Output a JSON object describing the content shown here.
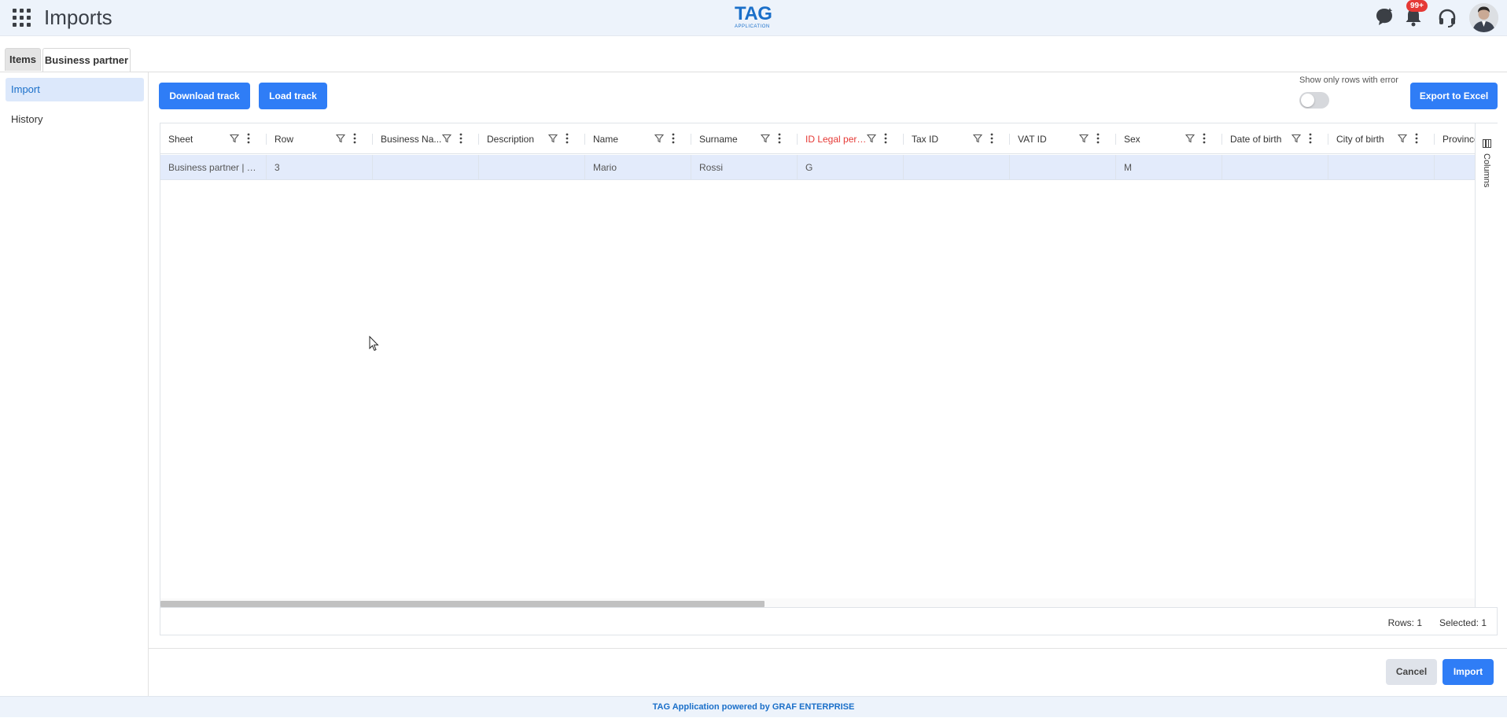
{
  "header": {
    "title": "Imports",
    "logo_main": "TAG",
    "logo_sub": "APPLICATION",
    "notification_badge": "99+",
    "icons": [
      "apps-grid-icon",
      "chat-heart-icon",
      "bell-icon",
      "headset-icon"
    ]
  },
  "tabs": [
    {
      "label": "Items",
      "active": false
    },
    {
      "label": "Business partner",
      "active": true
    }
  ],
  "sidebar": {
    "items": [
      {
        "label": "Import",
        "active": true
      },
      {
        "label": "History",
        "active": false
      }
    ]
  },
  "toolbar": {
    "download_label": "Download track",
    "load_label": "Load track",
    "toggle_label": "Show only rows with error",
    "toggle_on": false,
    "export_label": "Export to Excel"
  },
  "grid": {
    "columns": [
      "Sheet",
      "Row",
      "Business Na...",
      "Description",
      "Name",
      "Surname",
      "ID Legal pers...",
      "Tax ID",
      "VAT ID",
      "Sex",
      "Date of birth",
      "City of birth",
      "Province"
    ],
    "error_column": "ID Legal pers...",
    "rows": [
      [
        "Business partner | Tr...",
        "3",
        "",
        "",
        "Mario",
        "Rossi",
        "G",
        "",
        "",
        "M",
        "",
        "",
        ""
      ]
    ],
    "side_panel_label": "Columns",
    "footer_rows": "Rows: 1",
    "footer_selected": "Selected: 1"
  },
  "actions": {
    "cancel_label": "Cancel",
    "import_label": "Import"
  },
  "footer": {
    "text": "TAG Application powered by GRAF ENTERPRISE"
  },
  "colors": {
    "primary": "#2f7df6",
    "brand": "#1a6fc9",
    "error": "#e53935",
    "row_selected": "#e3ebfb",
    "header_bg": "#edf3fb"
  }
}
